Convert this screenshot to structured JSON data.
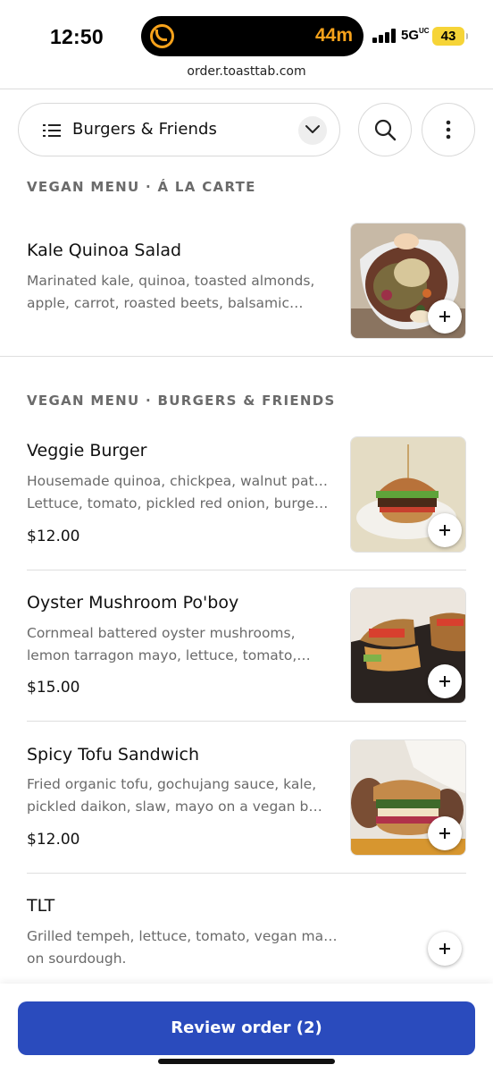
{
  "status_bar": {
    "time": "12:50",
    "timer_text": "44m",
    "network": "5G",
    "network_suffix": "UC",
    "battery": "43",
    "colors": {
      "timer": "#f7a21b",
      "battery": "#f6d437"
    }
  },
  "browser": {
    "url": "order.toasttab.com"
  },
  "category_bar": {
    "selected_category": "Burgers & Friends",
    "icons": [
      "list-icon",
      "chevron-down-icon",
      "search-icon",
      "more-vertical-icon"
    ]
  },
  "sections": [
    {
      "heading": "VEGAN MENU · Á LA CARTE",
      "items": [
        {
          "name": "Kale Quinoa Salad",
          "desc_line1": "Marinated kale, quinoa, toasted almonds,",
          "desc_line2": "apple, carrot, roasted beets, balsamic…",
          "price": "",
          "has_photo": true
        }
      ]
    },
    {
      "heading": "VEGAN MENU · BURGERS & FRIENDS",
      "items": [
        {
          "name": "Veggie Burger",
          "desc_line1": "Housemade quinoa, chickpea, walnut patty.",
          "desc_line2": "Lettuce, tomato, pickled red onion, burge…",
          "price": "$12.00",
          "has_photo": true
        },
        {
          "name": "Oyster Mushroom Po'boy",
          "desc_line1": "Cornmeal battered oyster mushrooms,",
          "desc_line2": "lemon tarragon mayo, lettuce, tomato,…",
          "price": "$15.00",
          "has_photo": true
        },
        {
          "name": "Spicy Tofu Sandwich",
          "desc_line1": "Fried organic tofu, gochujang sauce, kale,",
          "desc_line2": "pickled daikon, slaw, mayo on a vegan bu…",
          "price": "$12.00",
          "has_photo": true
        },
        {
          "name": "TLT",
          "desc_line1": "Grilled tempeh, lettuce, tomato, vegan mayo",
          "desc_line2": "on sourdough.",
          "price": "",
          "has_photo": false
        }
      ]
    }
  ],
  "footer": {
    "review_button": "Review order (2)",
    "accent_color": "#2a4bbd"
  }
}
